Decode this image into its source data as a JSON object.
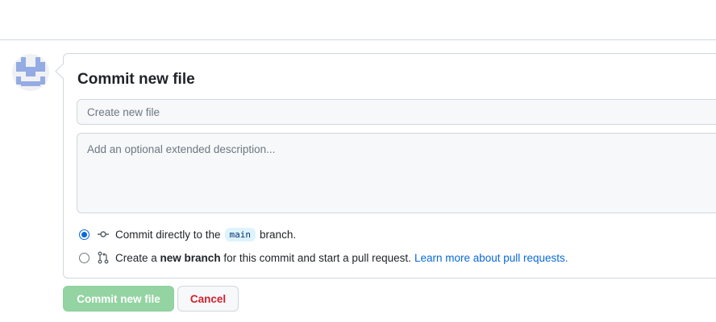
{
  "form": {
    "title": "Commit new file",
    "summary_placeholder": "Create new file",
    "description_placeholder": "Add an optional extended description..."
  },
  "options": {
    "direct": {
      "text_before": "Commit directly to the",
      "branch": "main",
      "text_after": "branch.",
      "selected": true
    },
    "new_branch": {
      "text_before": "Create a",
      "bold": "new branch",
      "text_after": "for this commit and start a pull request.",
      "link": "Learn more about pull requests.",
      "selected": false
    }
  },
  "buttons": {
    "commit": "Commit new file",
    "cancel": "Cancel"
  },
  "colors": {
    "accent": "#0969da",
    "commit_button": "#94d3a2",
    "cancel_text": "#cf222e"
  }
}
